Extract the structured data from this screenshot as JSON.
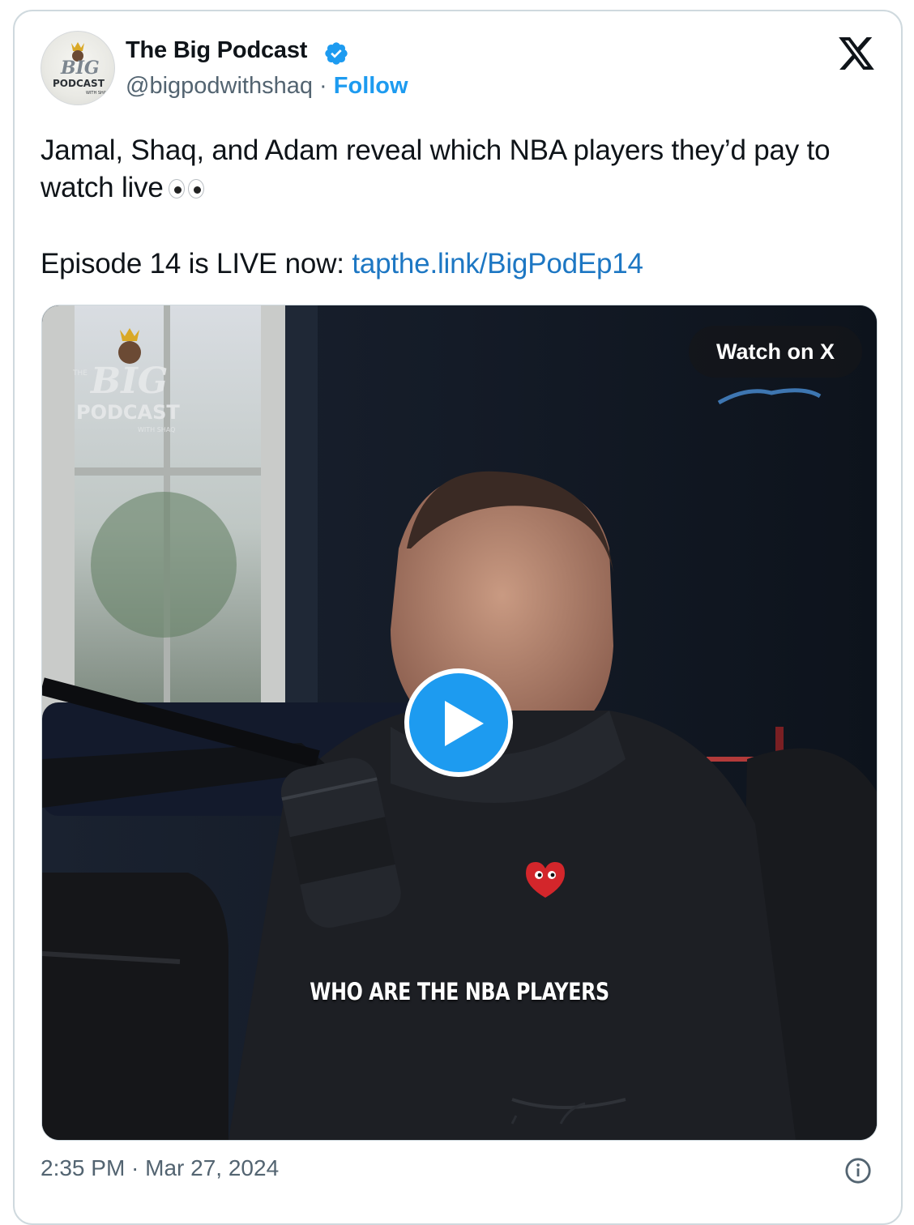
{
  "author": {
    "name": "The Big Podcast",
    "handle": "@bigpodwithshaq",
    "separator": " · ",
    "follow_label": "Follow"
  },
  "tweet": {
    "line1": "Jamal, Shaq, and Adam reveal which NBA players they’d pay to watch live",
    "line2_prefix": "Episode 14 is LIVE now: ",
    "link_text": "tapthe.link/BigPodEp14"
  },
  "media": {
    "watch_label": "Watch on X",
    "caption": "WHO ARE THE NBA PLAYERS",
    "logo": {
      "the": "THE",
      "big": "BIG",
      "podcast": "PODCAST",
      "with": "WITH SHAQ"
    }
  },
  "footer": {
    "timestamp": "2:35 PM · Mar 27, 2024"
  },
  "colors": {
    "accent": "#1d9bf0",
    "link": "#1d77c3",
    "secondary_text": "#536471",
    "border": "#cfd9de"
  },
  "icons": {
    "verified": "verified-badge-icon",
    "x": "x-logo-icon",
    "play": "play-icon",
    "info": "info-icon",
    "emoji": "eyes-emoji"
  }
}
